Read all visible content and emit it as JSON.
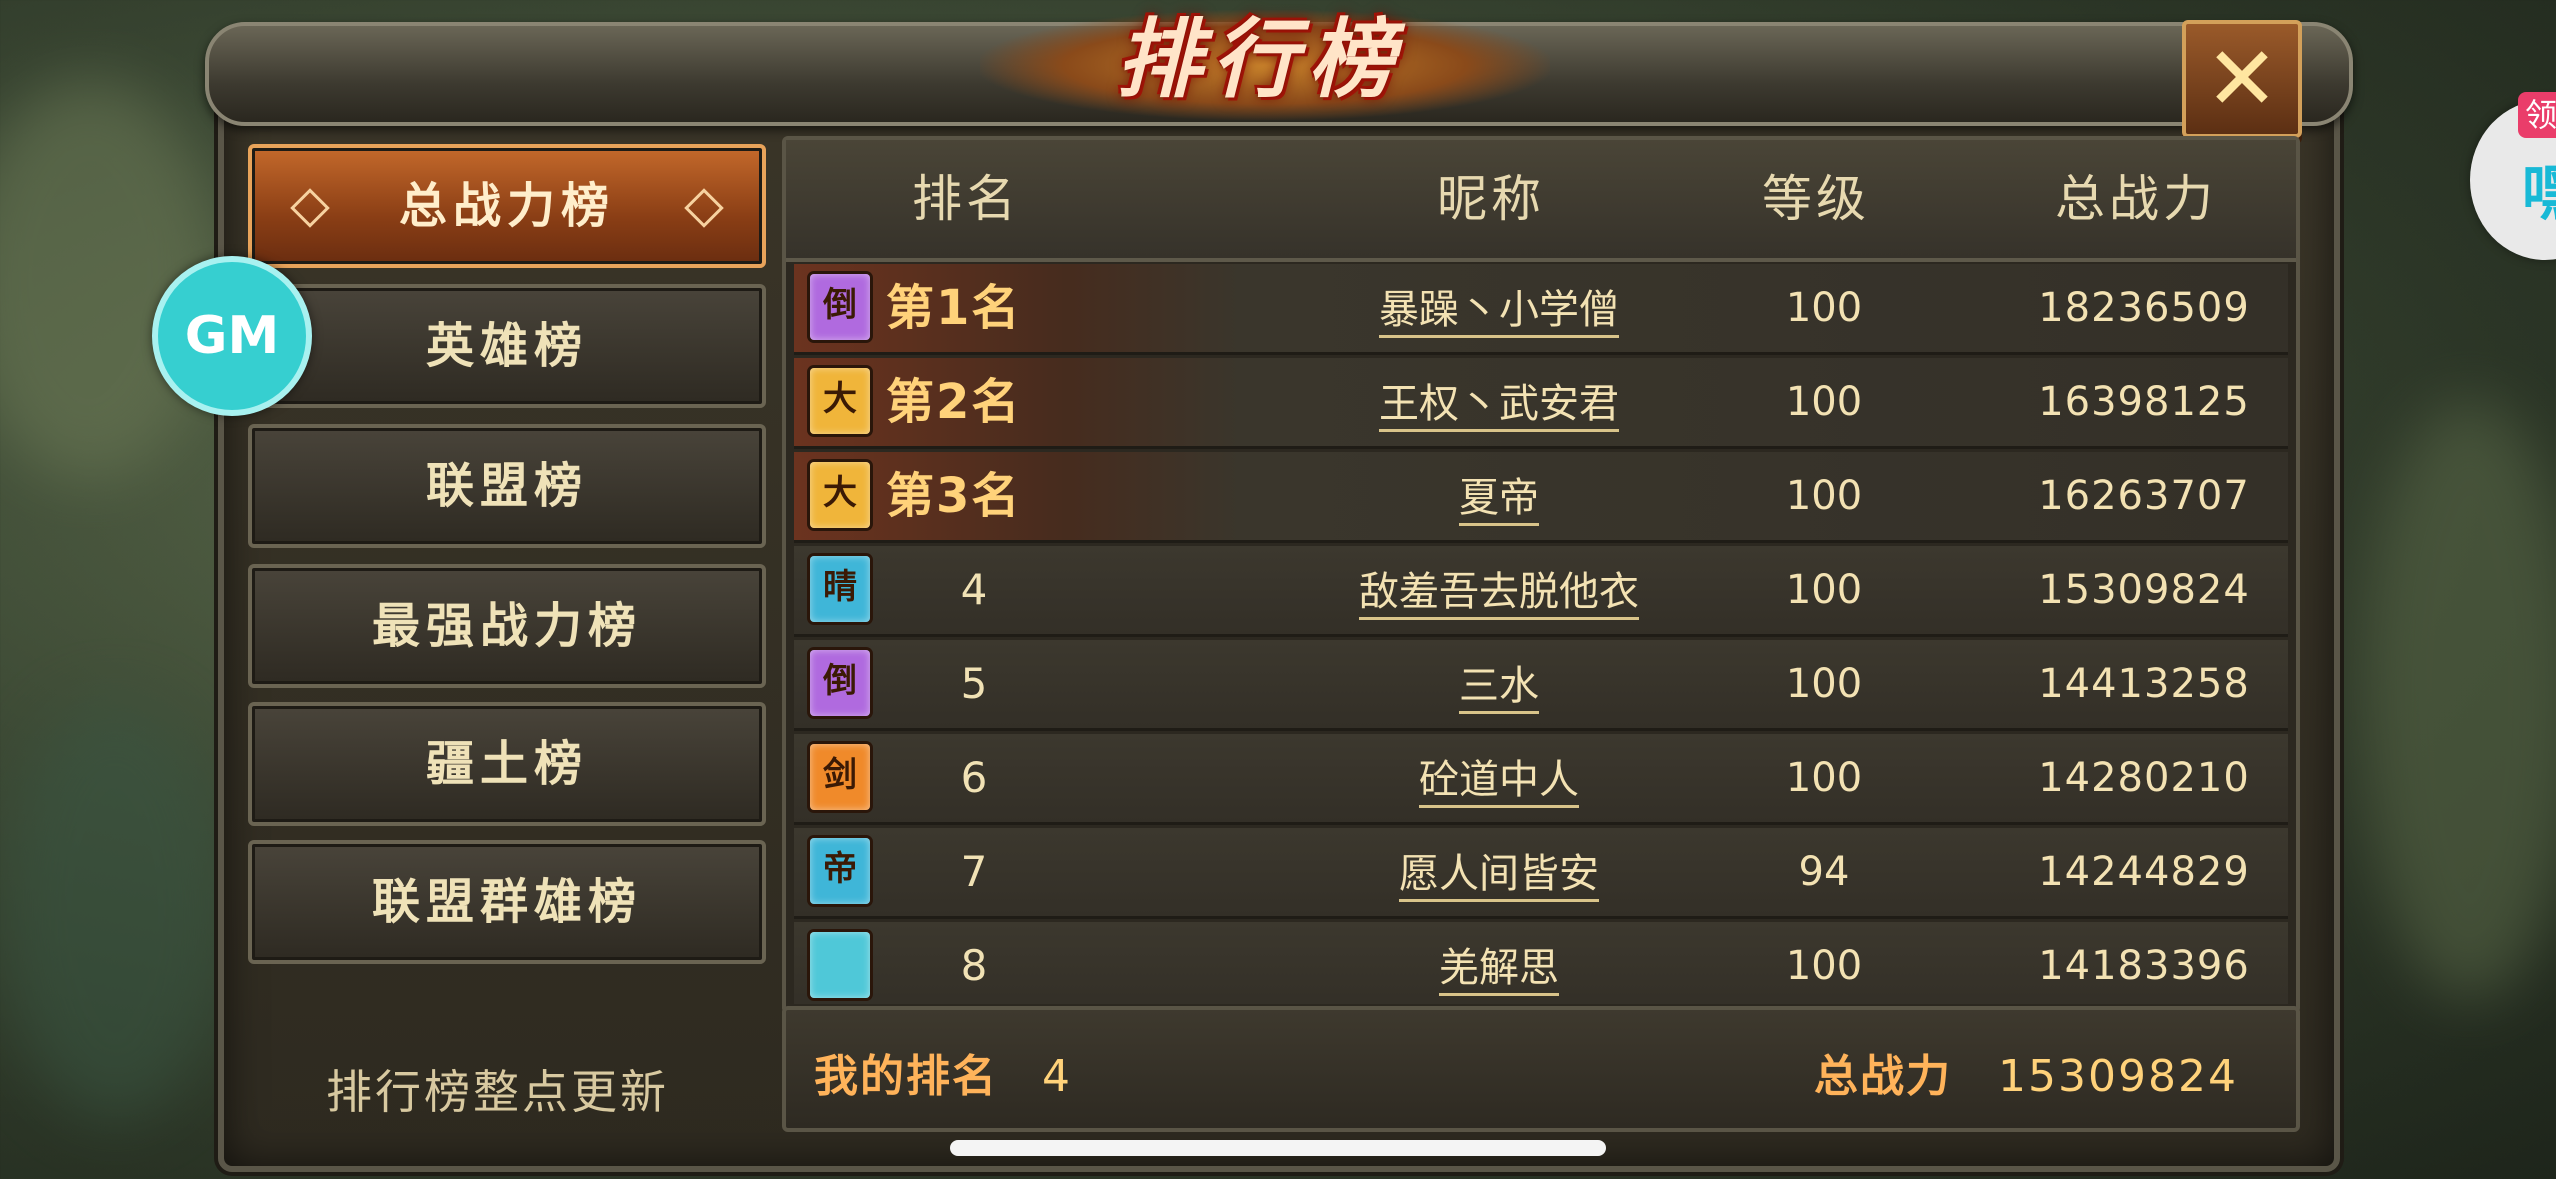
{
  "window": {
    "title": "排行榜",
    "close_icon": "close-x-icon"
  },
  "sidebar": {
    "items": [
      {
        "label": "总战力榜",
        "active": true
      },
      {
        "label": "英雄榜",
        "active": false
      },
      {
        "label": "联盟榜",
        "active": false
      },
      {
        "label": "最强战力榜",
        "active": false
      },
      {
        "label": "疆土榜",
        "active": false
      },
      {
        "label": "联盟群雄榜",
        "active": false
      }
    ],
    "update_note": "排行榜整点更新"
  },
  "gm_badge": {
    "label": "GM"
  },
  "table": {
    "headers": {
      "rank": "排名",
      "nickname": "昵称",
      "level": "等级",
      "power": "总战力"
    },
    "rows": [
      {
        "badge": "倒",
        "badge_color": "#b06adf",
        "rank": "第1名",
        "nickname": "暴躁丶小学僧",
        "level": "100",
        "power": "18236509"
      },
      {
        "badge": "大",
        "badge_color": "#f0b53a",
        "rank": "第2名",
        "nickname": "王权丶武安君",
        "level": "100",
        "power": "16398125"
      },
      {
        "badge": "大",
        "badge_color": "#f0b53a",
        "rank": "第3名",
        "nickname": "夏帝",
        "level": "100",
        "power": "16263707"
      },
      {
        "badge": "晴",
        "badge_color": "#3fb6d8",
        "rank": "4",
        "nickname": "敌羞吾去脱他衣",
        "level": "100",
        "power": "15309824"
      },
      {
        "badge": "倒",
        "badge_color": "#b06adf",
        "rank": "5",
        "nickname": "三水",
        "level": "100",
        "power": "14413258"
      },
      {
        "badge": "剑",
        "badge_color": "#f08a2a",
        "rank": "6",
        "nickname": "砼道中人",
        "level": "100",
        "power": "14280210"
      },
      {
        "badge": "帝",
        "badge_color": "#3fb6d8",
        "rank": "7",
        "nickname": "愿人间皆安",
        "level": "94",
        "power": "14244829"
      },
      {
        "badge": "",
        "badge_color": "#4fc8d8",
        "rank": "8",
        "nickname": "羌解思",
        "level": "100",
        "power": "14183396"
      }
    ]
  },
  "footer": {
    "my_rank_label": "我的排名",
    "my_rank_value": "4",
    "power_label": "总战力",
    "power_value": "15309824"
  },
  "side_widget": {
    "tag": "领",
    "text": "嘿"
  }
}
